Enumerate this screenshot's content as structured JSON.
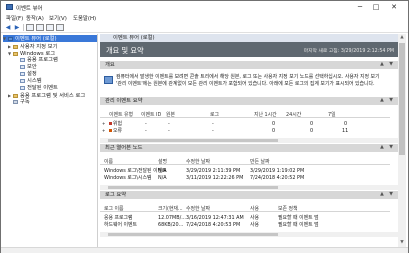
{
  "window": {
    "title": "이벤트 뷰어",
    "controls": {
      "minimize": "─",
      "maximize": "□",
      "close": "✕"
    }
  },
  "menu": [
    "파일(F)",
    "동작(A)",
    "보기(V)",
    "도움말(H)"
  ],
  "toolbar": {
    "back": "◀",
    "forward": "▶"
  },
  "tree": {
    "root": "이벤트 뷰어 (로컬)",
    "custom_views": "사용자 지정 보기",
    "windows_logs": "Windows 로그",
    "windows_children": [
      "응용 프로그램",
      "보안",
      "설정",
      "시스템",
      "전달된 이벤트"
    ],
    "apps_services": "응용 프로그램 및 서비스 로그",
    "subscriptions": "구독"
  },
  "main": {
    "breadcrumb": "이벤트 뷰어 (로컬)",
    "header_title": "개요 및 요약",
    "header_time": "마지막 새로 고침: 3/29/2019 2:12:54 PM",
    "overview": {
      "title": "개요",
      "line1": "컴퓨터에서 발생한 이벤트를 보려면 콘솔 트리에서 해당 원본, 로그 또는 사용자 지정 보기 노드를 선택하십시오. 사용자 지정 보기",
      "line2": "'관리 이벤트'에는 원본에 관계없이 모든 관리 이벤트가 포함되어 있습니다. 아래에 모든 로그의 집계 보기가 표시되어 있습니다."
    },
    "admin_summary": {
      "title": "관리 이벤트 요약",
      "columns": [
        "이벤트 유형",
        "이벤트 ID",
        "원본",
        "로그",
        "지난 1시간",
        "24시간",
        "7일"
      ],
      "rows": [
        {
          "type": "위험",
          "id": "-",
          "source": "-",
          "log": "-",
          "h1": "0",
          "h24": "0",
          "d7": "0"
        },
        {
          "type": "오류",
          "id": "-",
          "source": "-",
          "log": "-",
          "h1": "0",
          "h24": "0",
          "d7": "11"
        }
      ]
    },
    "recent_nodes": {
      "title": "최근 열어본 노드",
      "columns": [
        "이름",
        "설명",
        "수정한 날짜",
        "만든 날짜"
      ],
      "rows": [
        {
          "name": "Windows 로그\\전달된 이벤트",
          "desc": "N/A",
          "modified": "3/29/2019 2:11:39 PM",
          "created": "3/29/2019 1:19:02 PM"
        },
        {
          "name": "Windows 로그\\시스템",
          "desc": "N/A",
          "modified": "3/11/2019 12:22:26 PM",
          "created": "7/24/2018 4:20:52 PM"
        }
      ]
    },
    "log_summary": {
      "title": "로그 요약",
      "columns": [
        "로그 이름",
        "크기(현재...",
        "수정한 날짜",
        "사용",
        "보존 정책"
      ],
      "rows": [
        {
          "name": "응용 프로그램",
          "size": "12.07MB/...",
          "modified": "3/16/2019 12:47:31 AM",
          "used": "사용",
          "policy": "필요할 때 이벤트 덮"
        },
        {
          "name": "하드웨어 이벤트",
          "size": "68KB/20...",
          "modified": "7/24/2018 4:20:53 PM",
          "used": "사용",
          "policy": "필요할 때 이벤트 덮"
        }
      ]
    },
    "section_controls": "▲ ▼"
  },
  "colors": {
    "header_bg": "#5f6870",
    "selected": "#3a78d8",
    "section_bg": "#d7d7d7",
    "breadcrumb_bg": "#dee4ee",
    "critical": "#c0392b",
    "error": "#d35400"
  }
}
